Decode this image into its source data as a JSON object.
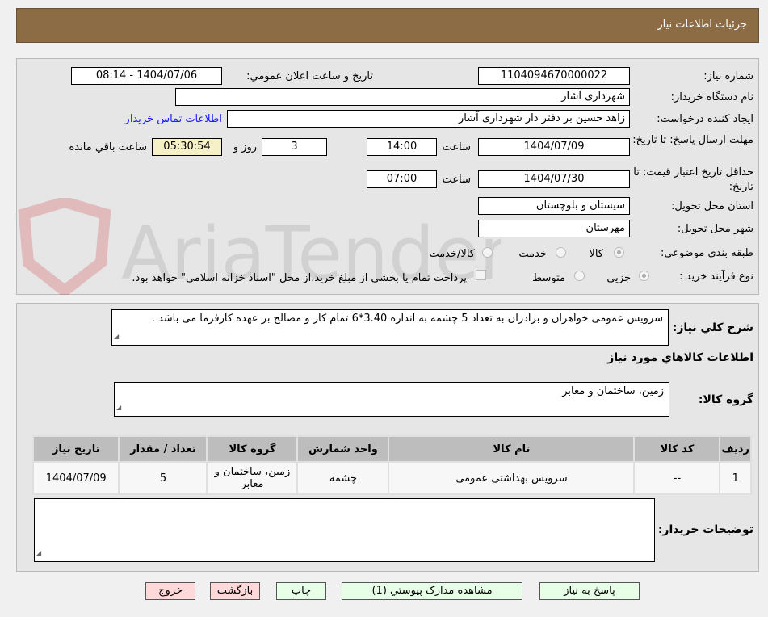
{
  "header": {
    "title": "جزئیات اطلاعات نیاز"
  },
  "form": {
    "need_number_label": "شماره نیاز:",
    "need_number": "1104094670000022",
    "announce_label": "تاریخ و ساعت اعلان عمومي:",
    "announce_value": "1404/07/06 - 08:14",
    "buyer_org_label": "نام دستگاه خریدار:",
    "buyer_org": "شهرداری آشار",
    "creator_label": "ایجاد کننده درخواست:",
    "creator": "زاهد حسین بر دفتر دار شهرداری آشار",
    "contact_link": "اطلاعات تماس خریدار",
    "deadline_label": "مهلت ارسال پاسخ: تا تاریخ:",
    "deadline_date": "1404/07/09",
    "time_label": "ساعت",
    "deadline_time": "14:00",
    "days": "3",
    "days_label": "روز و",
    "remaining": "05:30:54",
    "remaining_label": "ساعت باقي مانده",
    "validity_label": "حداقل تاریخ اعتبار قیمت: تا تاریخ:",
    "validity_date": "1404/07/30",
    "validity_time": "07:00",
    "province_label": "استان محل تحویل:",
    "province": "سیستان و بلوچستان",
    "city_label": "شهر محل تحویل:",
    "city": "مهرستان",
    "category_label": "طبقه بندی موضوعی:",
    "category_options": [
      "کالا",
      "خدمت",
      "کالا/خدمت"
    ],
    "process_label": "نوع فرآیند خرید :",
    "process_options": [
      "جزیي",
      "متوسط"
    ],
    "payment_note": "پرداخت تمام یا بخشی از مبلغ خرید،از محل \"اسناد خزانه اسلامی\" خواهد بود."
  },
  "details": {
    "desc_label": "شرح كلي نياز:",
    "desc": "سرویس عمومی خواهران و برادران به تعداد 5 چشمه به اندازه 3.40*6 تمام کار  و مصالح بر عهده کارفرما می باشد .",
    "goods_heading": "اطلاعات كالاهاي مورد نياز",
    "group_label": "گروه کالا:",
    "group": "زمین، ساختمان و معابر",
    "table": {
      "headers": [
        "ردیف",
        "کد کالا",
        "نام کالا",
        "واحد شمارش",
        "گروه کالا",
        "تعداد / مقدار",
        "تاریخ نیاز"
      ],
      "rows": [
        [
          "1",
          "--",
          "سرویس بهداشتی عمومی",
          "چشمه",
          "زمین، ساختمان و معابر",
          "5",
          "1404/07/09"
        ]
      ]
    },
    "notes_label": "توضیحات خریدار:"
  },
  "buttons": {
    "reply": "پاسخ به نیاز",
    "docs": "مشاهده مدارک پیوستي (1)",
    "print": "چاپ",
    "back": "بازگشت",
    "exit": "خروج"
  },
  "watermark": "AriaTender.net"
}
